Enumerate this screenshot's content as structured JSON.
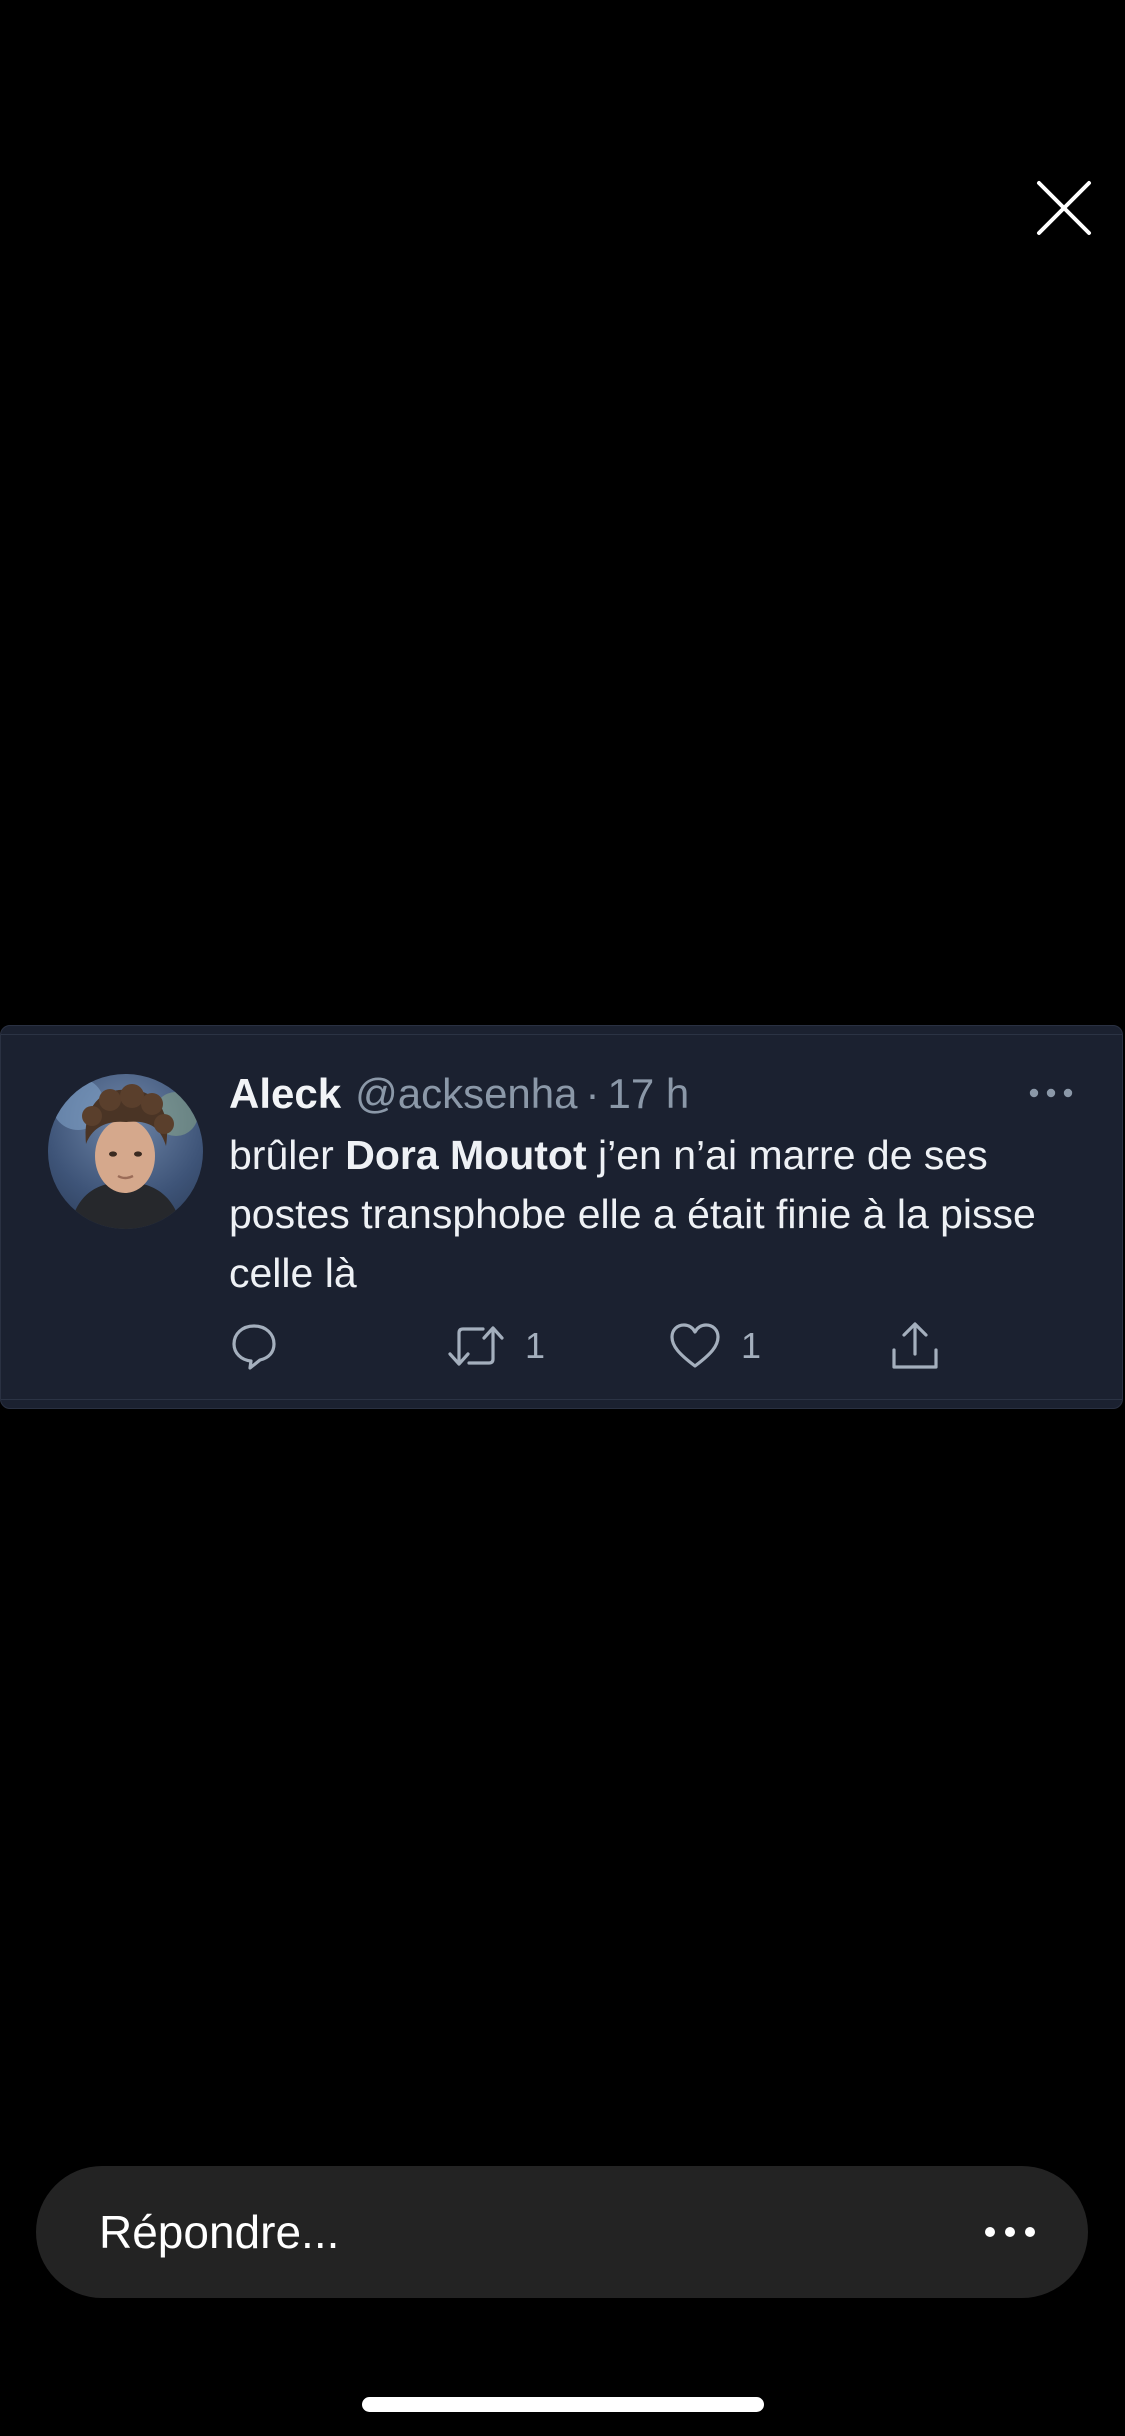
{
  "viewer": {
    "close_icon": "close-icon"
  },
  "tweet": {
    "author_name": "Aleck",
    "author_handle": "@acksenha",
    "separator": "·",
    "time": "17 h",
    "more_icon": "more-horizontal-icon",
    "text_before": "brûler ",
    "mention": "Dora Moutot",
    "text_after": " j’en n’ai marre de ses postes transphobe elle a était finie à la pisse celle là",
    "actions": {
      "reply_icon": "reply-icon",
      "retweet_icon": "retweet-icon",
      "retweet_count": "1",
      "like_icon": "heart-icon",
      "like_count": "1",
      "share_icon": "share-icon"
    }
  },
  "reply_bar": {
    "placeholder": "Répondre...",
    "more_icon": "more-horizontal-icon"
  },
  "colors": {
    "background": "#000000",
    "card": "#1b2130",
    "text_secondary": "#8b98a8",
    "reply_bar": "#232323"
  }
}
